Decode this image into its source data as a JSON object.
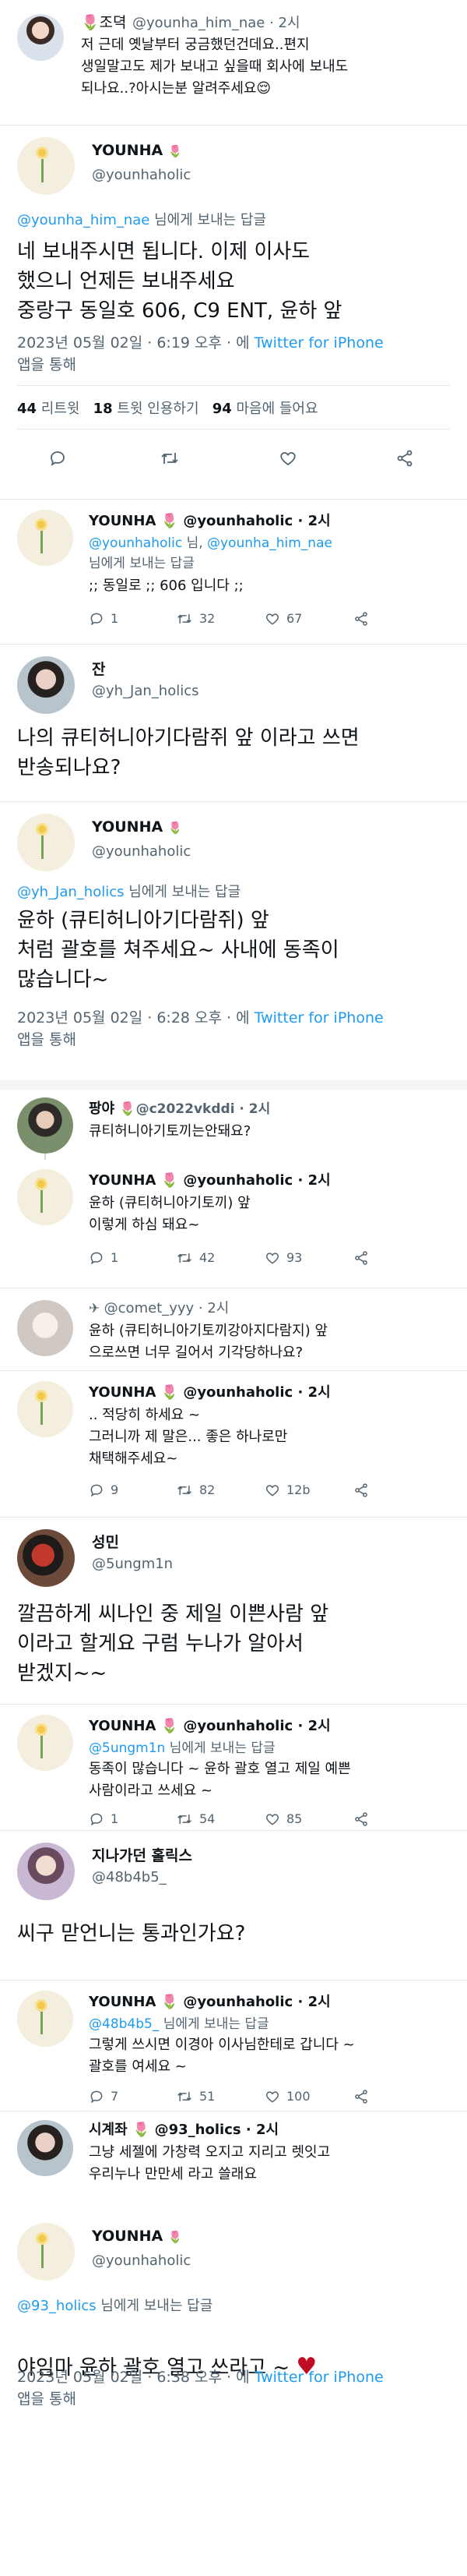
{
  "icons": {
    "reply": "reply-icon",
    "retweet": "retweet-icon",
    "like": "heart-icon",
    "share": "share-icon",
    "compose": "paper-plane-icon"
  },
  "colors": {
    "link": "#1d9bf0",
    "text": "#0f1419",
    "muted": "#536471",
    "heart": "#c00d24"
  },
  "t1": {
    "name": "🌷조뎍",
    "handle": "@younha_him_nae · 2시",
    "text": "저 근데 옛날부터 궁금했던건데요..편지\n생일말고도 제가 보내고 싶을때 회사에 보내도\n되나요..?아시는분 알려주세요😌"
  },
  "t2": {
    "name": "YOUNHA",
    "handle": "@younhaholic",
    "reply_to": "@younha_him_nae",
    "reply_suffix": " 님에게 보내는 답글",
    "text": "네 보내주시면 됩니다. 이제 이사도\n했으니 언제든 보내주세요\n중랑구 동일호 606, C9 ENT, 윤하 앞",
    "timestamp": "2023년 05월 02일 · 6:19 오후 · 에 ",
    "source": "Twitter for iPhone",
    "source_suffix": "앱을 통해",
    "retweets_n": "44",
    "retweets_l": " 리트윗",
    "quotes_n": "18",
    "quotes_l": " 트윗 인용하기",
    "likes_n": "94",
    "likes_l": " 마음에 들어요"
  },
  "t3": {
    "name": "YOUNHA 🌷 @younhaholic · 2시",
    "reply_line1_a": "@younhaholic",
    "reply_line1_b": " 님, ",
    "reply_line1_c": "@younha_him_nae",
    "reply_line2": "님에게 보내는 답글",
    "text": ";; 동일로 ;; 606 입니다 ;;",
    "replies": "1",
    "retweets": "32",
    "likes": "67"
  },
  "t4": {
    "name": "잔",
    "handle": "@yh_Jan_holics",
    "text": "나의 큐티허니아기다람쥐 앞 이라고 쓰면\n반송되나요?"
  },
  "t5": {
    "name": "YOUNHA",
    "handle": "@younhaholic",
    "reply_to": "@yh_Jan_holics",
    "reply_suffix": " 님에게 보내는 답글",
    "text": "윤하 (큐티허니아기다람쥐) 앞\n처럼 괄호를 쳐주세요~ 사내에 동족이\n많습니다~",
    "timestamp": "2023년 05월 02일 · 6:28 오후 · 에 ",
    "source": "Twitter for iPhone",
    "source_suffix": "앱을 통해"
  },
  "t6": {
    "name": "팡야",
    "handle": "🌷@c2022vkddi · 2시",
    "text": "큐티허니아기토끼는안돼요?"
  },
  "t7": {
    "name": "YOUNHA 🌷 @younhaholic · 2시",
    "text": "윤하 (큐티허니아기토끼) 앞\n이렇게 하심 돼요~",
    "replies": "1",
    "retweets": "42",
    "likes": "93"
  },
  "t8": {
    "name": "@comet_yyy · 2시",
    "text": "윤하 (큐티허니아기토끼강아지다람지) 앞\n으로쓰면 너무 길어서 기각당하나요?"
  },
  "t9": {
    "name": "YOUNHA 🌷 @younhaholic · 2시",
    "text": ".. 적당히 하세요 ~\n그러니까 제 말은... 좋은 하나로만\n채택해주세요~",
    "replies": "9",
    "retweets": "82",
    "likes": "12b"
  },
  "t10": {
    "name": "성민",
    "handle": "@5ungm1n",
    "text": "깔끔하게 씨나인 중 제일 이쁜사람 앞\n이라고 할게요 구럼 누나가 알아서\n받겠지~~"
  },
  "t11": {
    "name": "YOUNHA 🌷 @younhaholic · 2시",
    "reply_to": "@5ungm1n",
    "reply_suffix": " 님에게 보내는 답글",
    "text": "동족이 많습니다 ~ 윤하 괄호 열고 제일 예쁜\n사람이라고 쓰세요 ~",
    "replies": "1",
    "retweets": "54",
    "likes": "85"
  },
  "t12": {
    "name": "지나가던 홀릭스",
    "handle": "@48b4b5_",
    "text": "씨구 맏언니는 통과인가요?"
  },
  "t13": {
    "name": "YOUNHA 🌷 @younhaholic · 2시",
    "reply_to": "@48b4b5_",
    "reply_suffix": " 님에게 보내는 답글",
    "text": "그렇게 쓰시면 이경아 이사님한테로 갑니다 ~\n괄호를 여세요 ~",
    "replies": "7",
    "retweets": "51",
    "likes": "100"
  },
  "t14": {
    "name": "시계좌 🌷 @93_holics · 2시",
    "text": "그냥 세젤에 가창력 오지고 지리고 렛잇고\n우리누나 만만세 라고 쓸래요"
  },
  "t15": {
    "name": "YOUNHA",
    "handle": "@younhaholic",
    "reply_to": "@93_holics",
    "reply_suffix": " 님에게 보내는 답글",
    "text": "야임마 윤하 괄호 열고 쓰라고 ~ ",
    "heart": "♥",
    "timestamp": "2023년 05월 02일 · 6:38 오후 · 에 ",
    "source": "Twitter for iPhone",
    "source_suffix": "앱을 통해"
  }
}
